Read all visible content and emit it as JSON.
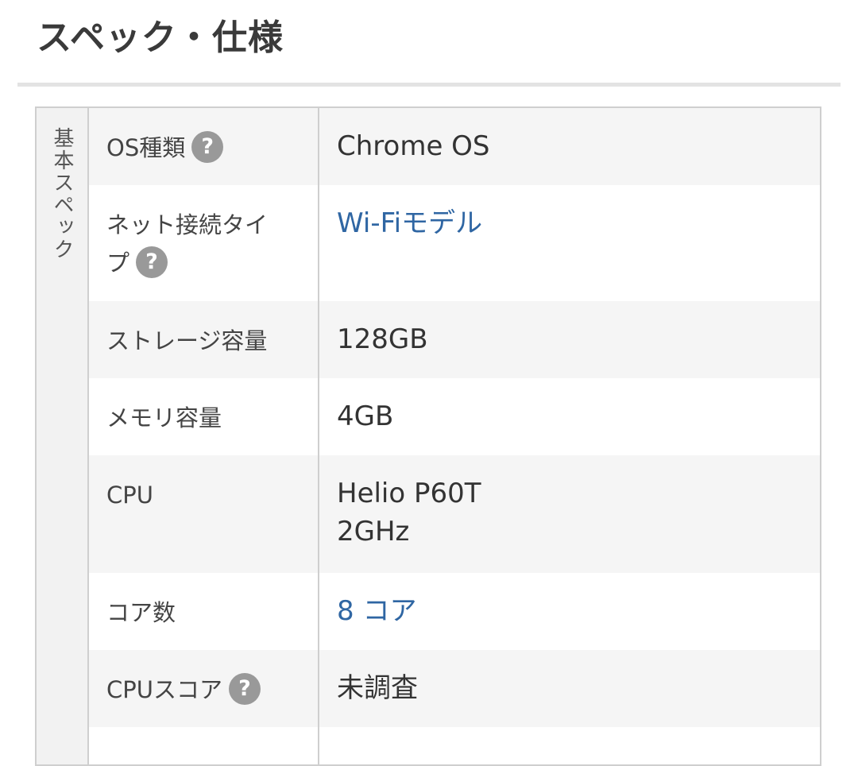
{
  "page": {
    "title": "スペック・仕様"
  },
  "spec_group": {
    "label": "基本スペック"
  },
  "help_glyph": "?",
  "rows": [
    {
      "label": "OS種類",
      "value": "Chrome OS"
    },
    {
      "label": "ネット接続タイプ",
      "value": "Wi-Fiモデル"
    },
    {
      "label": "ストレージ容量",
      "value": "128GB"
    },
    {
      "label": "メモリ容量",
      "value": "4GB"
    },
    {
      "label": "CPU",
      "value_line1": "Helio P60T",
      "value_line2": "2GHz"
    },
    {
      "label": "コア数",
      "value": "8 コア"
    },
    {
      "label": "CPUスコア",
      "value": "未調査"
    },
    {
      "label": "",
      "value": ""
    }
  ],
  "colors": {
    "link": "#2f66a3",
    "border": "#cfcfcf",
    "help_bg": "#999999"
  }
}
